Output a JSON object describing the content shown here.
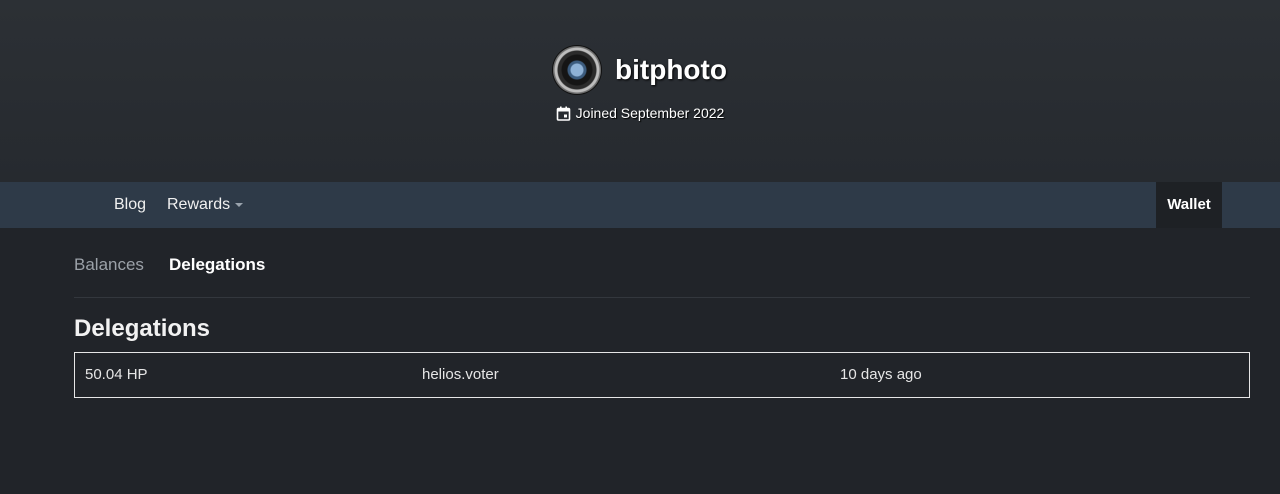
{
  "profile": {
    "username": "bitphoto",
    "joined": "Joined September 2022",
    "icons": {
      "avatar": "camera-lens-avatar",
      "calendar": "calendar-icon"
    }
  },
  "nav": {
    "blog": "Blog",
    "rewards": "Rewards",
    "wallet": "Wallet"
  },
  "subtabs": {
    "balances": "Balances",
    "delegations": "Delegations",
    "active": "Delegations"
  },
  "section": {
    "title": "Delegations"
  },
  "delegations": [
    {
      "amount": "50.04 HP",
      "delegatee": "helios.voter",
      "time": "10 days ago"
    }
  ],
  "colors": {
    "background": "#212429",
    "navbar": "#2e3a48",
    "wallet_tab": "#1e2125"
  }
}
